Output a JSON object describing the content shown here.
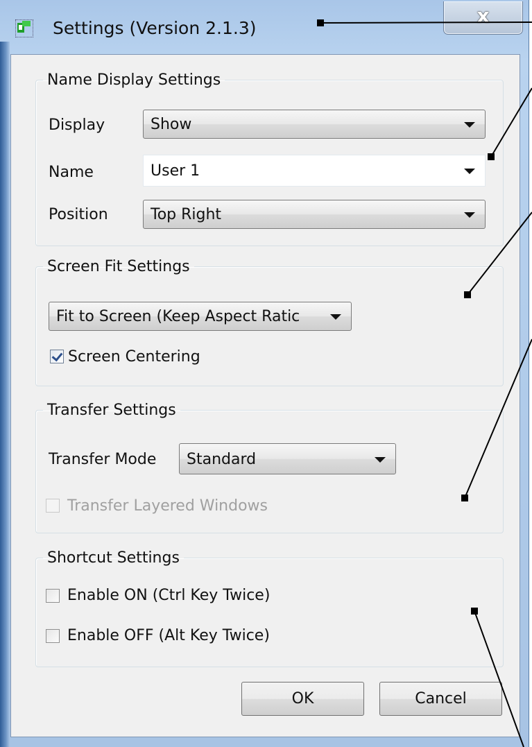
{
  "window": {
    "title": "Settings (Version 2.1.3)",
    "close_glyph": "x",
    "app_icon": "app-icon"
  },
  "name_display": {
    "legend": "Name Display Settings",
    "display_label": "Display",
    "display_value": "Show",
    "name_label": "Name",
    "name_value": "User 1",
    "position_label": "Position",
    "position_value": "Top Right"
  },
  "screen_fit": {
    "legend": "Screen Fit Settings",
    "mode_value": "Fit to Screen (Keep Aspect Ratic",
    "centering_label": "Screen Centering",
    "centering_checked": true
  },
  "transfer": {
    "legend": "Transfer Settings",
    "mode_label": "Transfer Mode",
    "mode_value": "Standard",
    "layered_label": "Transfer Layered Windows",
    "layered_checked": false,
    "layered_enabled": false
  },
  "shortcut": {
    "legend": "Shortcut Settings",
    "enable_on_label": "Enable ON (Ctrl Key Twice)",
    "enable_on_checked": false,
    "enable_off_label": "Enable OFF (Alt Key Twice)",
    "enable_off_checked": false
  },
  "buttons": {
    "ok": "OK",
    "cancel": "Cancel"
  },
  "colors": {
    "frame": "#a9c6e8",
    "client": "#f0f0f0",
    "checkmark": "#2b4f8c",
    "annotation": "#000000"
  }
}
